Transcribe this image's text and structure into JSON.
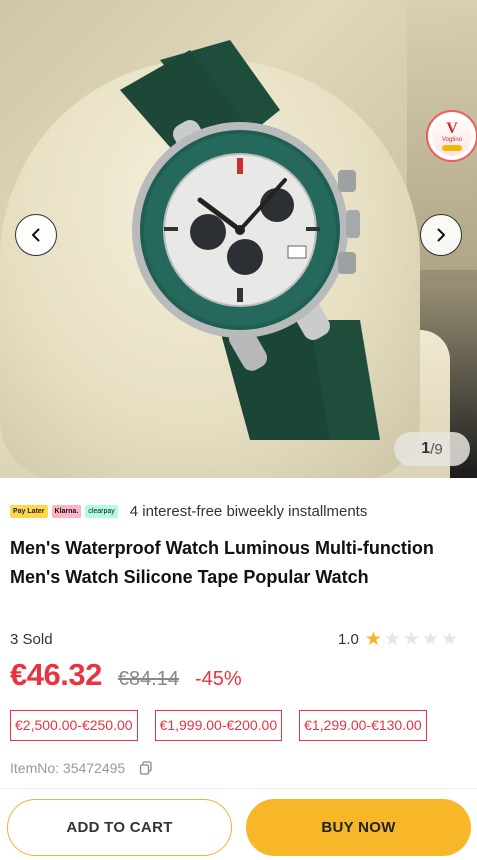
{
  "gallery": {
    "current": "1",
    "separator": "/",
    "total": "9",
    "prev_icon": "chevron-left-icon",
    "next_icon": "chevron-right-icon",
    "badge_text": "Vogtino"
  },
  "installments": {
    "tags": [
      "Pay Later",
      "Klarna.",
      "clearpay"
    ],
    "text": "4 interest-free biweekly installments"
  },
  "product": {
    "title": "Men's Waterproof Watch Luminous Multi-function Men's Watch Silicone Tape Popular Watch",
    "sold": "3 Sold",
    "rating": "1.0",
    "rating_stars": 1,
    "rating_max": 5,
    "price": "€46.32",
    "old_price": "€84.14",
    "discount": "-45%",
    "item_no": "ItemNo: 35472495"
  },
  "coupons": [
    "€2,500.00-€250.00",
    "€1,999.00-€200.00",
    "€1,299.00-€130.00"
  ],
  "actions": {
    "add_to_cart": "ADD TO CART",
    "buy_now": "BUY NOW"
  },
  "colors": {
    "accent": "#e8343f",
    "button": "#f8b629",
    "star": "#f5b42a"
  }
}
